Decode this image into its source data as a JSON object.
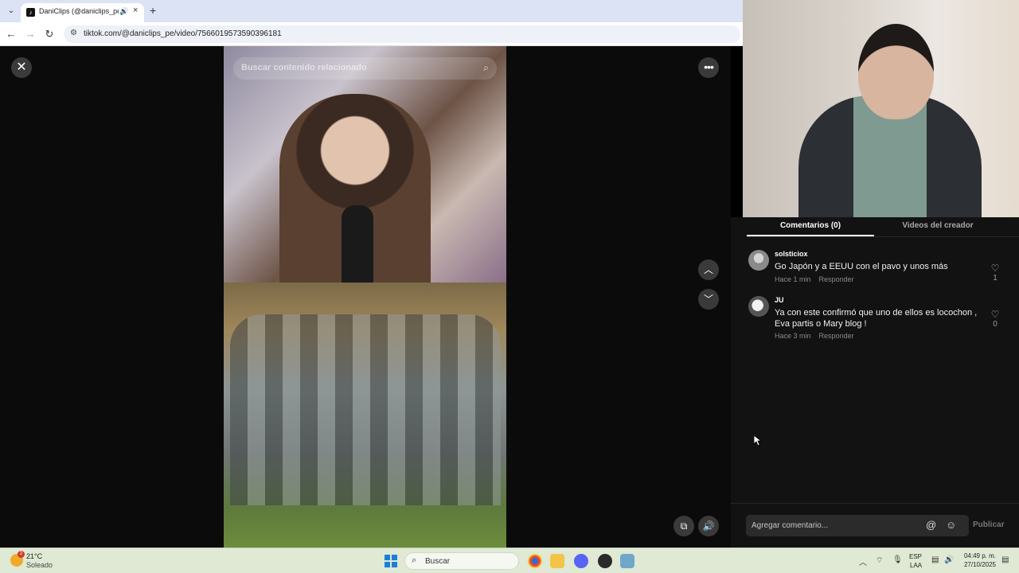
{
  "browser": {
    "tab_title": "DaniClips (@daniclips_pe) |",
    "favicon_glyph": "♪",
    "tab_audio_glyph": "🔊",
    "tab_close_glyph": "×",
    "new_tab_glyph": "+",
    "back_glyph": "←",
    "forward_glyph": "→",
    "reload_glyph": "↻",
    "site_info_glyph": "⚙",
    "url": "tiktok.com/@daniclips_pe/video/7566019573590396181"
  },
  "viewer": {
    "close_glyph": "✕",
    "more_glyph": "•••",
    "search_placeholder": "Buscar contenido relacionado",
    "search_glyph": "⌕",
    "up_glyph": "︿",
    "down_glyph": "﹀",
    "pip_glyph": "⧉",
    "volume_glyph": "🔊"
  },
  "panel": {
    "tabs": [
      {
        "label": "Comentarios (0)",
        "active": true
      },
      {
        "label": "Videos del creador",
        "active": false
      }
    ],
    "comments": [
      {
        "author": "solsticiox",
        "text": "Go Japón y a EEUU con el pavo y unos más",
        "time": "Hace 1 min",
        "reply": "Responder",
        "likes": "1"
      },
      {
        "author": "JU",
        "text": "Ya con este confirmó que uno de ellos es locochon , Eva partis o Mary blog !",
        "time": "Hace 3 min",
        "reply": "Responder",
        "likes": "0"
      }
    ],
    "like_glyph": "♡",
    "input_placeholder": "Agregar comentario...",
    "mention_glyph": "@",
    "emoji_glyph": "☺",
    "publish": "Publicar"
  },
  "taskbar": {
    "weather_badge": "2",
    "temperature": "21°C",
    "condition": "Soleado",
    "search_glyph": "⌕",
    "search_label": "Buscar",
    "lang_top": "ESP",
    "lang_bottom": "LAA",
    "time": "04:49 p. m.",
    "date": "27/10/2025",
    "tray_up_glyph": "︿",
    "wifi_glyph": "⌔",
    "mic_glyph": "🎙",
    "speaker_glyph": "🔊",
    "notify_glyph": "▤"
  },
  "colors": {
    "accent_white": "#ffffff",
    "panel_bg": "#121212",
    "taskbar_bg": "#dfe9d4"
  }
}
